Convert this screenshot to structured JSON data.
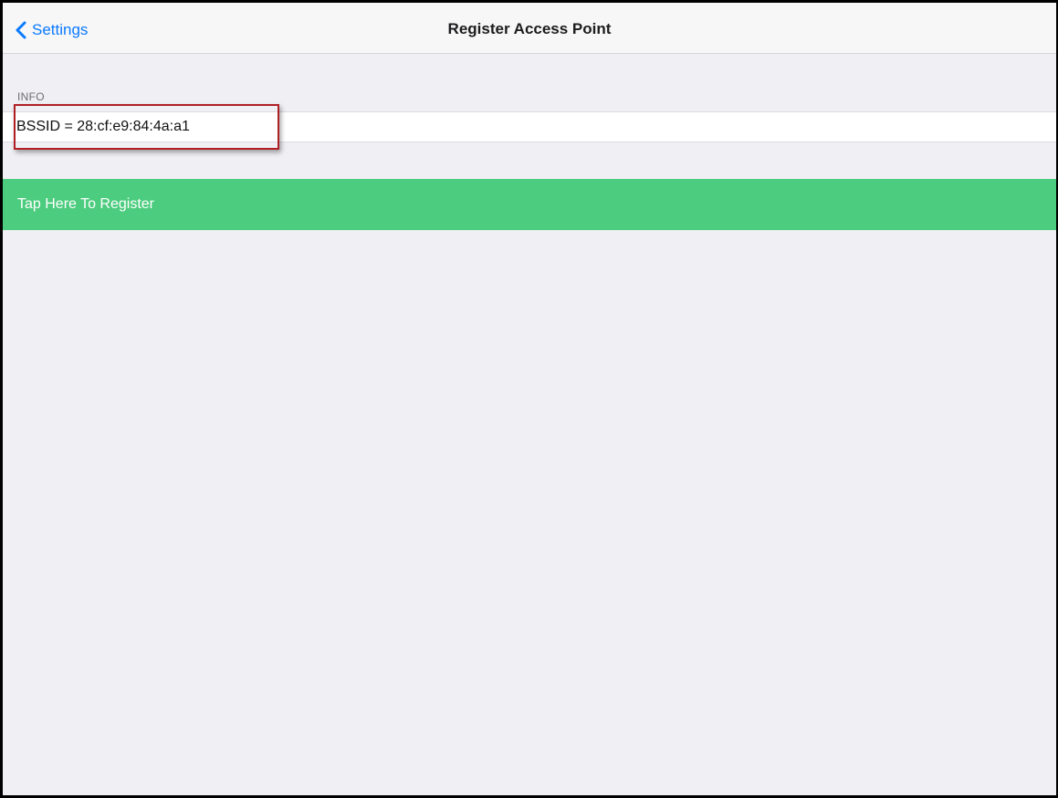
{
  "navbar": {
    "back_label": "Settings",
    "title": "Register Access Point"
  },
  "info_section": {
    "header": "INFO",
    "bssid_text": "BSSID = 28:cf:e9:84:4a:a1"
  },
  "register": {
    "label": "Tap Here To Register"
  },
  "colors": {
    "accent": "#0a7aff",
    "register_button": "#4ccc7e",
    "background": "#efeff4",
    "highlight": "#b01f24"
  },
  "icons": {
    "back": "chevron-left-icon"
  }
}
